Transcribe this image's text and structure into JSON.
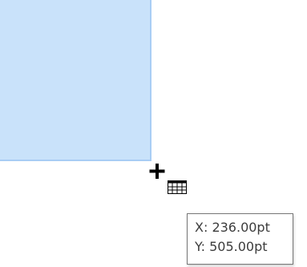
{
  "colors": {
    "selection_fill": "#c9e2fa",
    "selection_border": "#a8cdf4",
    "tooltip_text": "#3c3c3c",
    "tooltip_border": "#767676"
  },
  "cursor": {
    "icon": "crosshair-table-icon"
  },
  "tooltip": {
    "x_line": "X: 236.00pt",
    "y_line": "Y: 505.00pt"
  }
}
